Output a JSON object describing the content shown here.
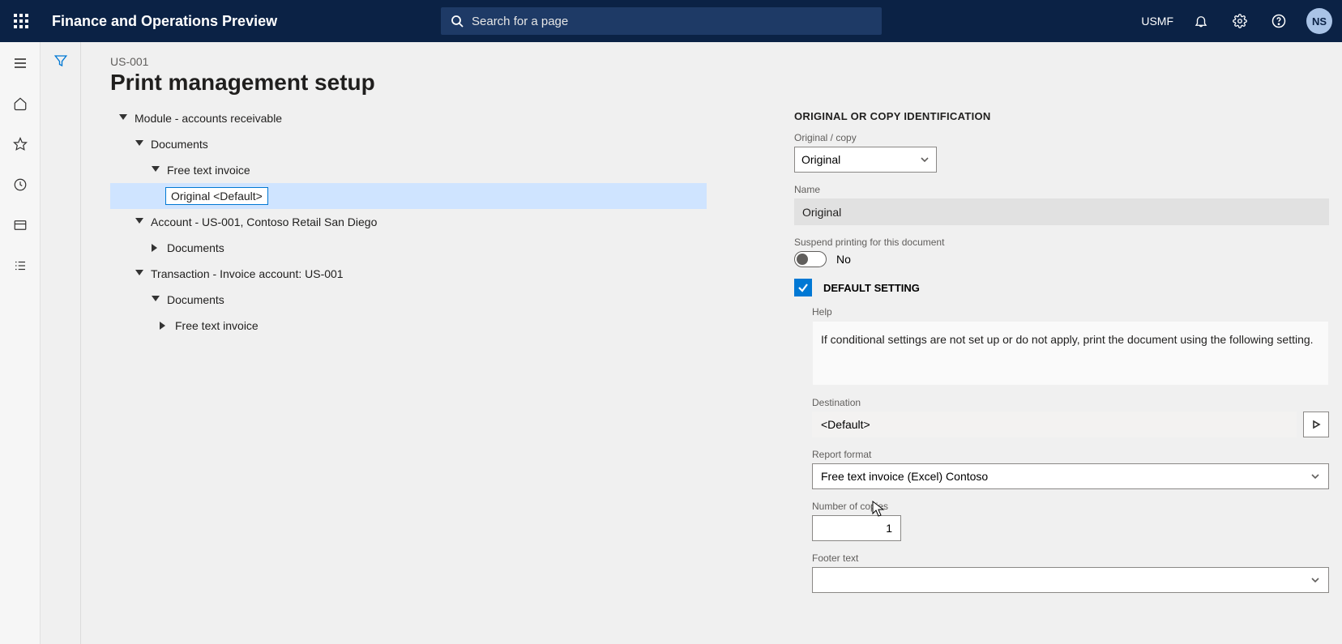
{
  "header": {
    "app_title": "Finance and Operations Preview",
    "search_placeholder": "Search for a page",
    "company": "USMF",
    "avatar_initials": "NS"
  },
  "page": {
    "crumb": "US-001",
    "title": "Print management setup"
  },
  "tree": {
    "module": "Module - accounts receivable",
    "documents": "Documents",
    "free_text_invoice": "Free text invoice",
    "original_default": "Original <Default>",
    "account": "Account - US-001, Contoso Retail San Diego",
    "account_documents": "Documents",
    "transaction": "Transaction - Invoice account: US-001",
    "trans_documents": "Documents",
    "trans_free_text": "Free text invoice"
  },
  "form": {
    "section_id_title": "ORIGINAL OR COPY IDENTIFICATION",
    "original_copy_label": "Original / copy",
    "original_copy_value": "Original",
    "name_label": "Name",
    "name_value": "Original",
    "suspend_label": "Suspend printing for this document",
    "suspend_value": "No",
    "default_setting_label": "DEFAULT SETTING",
    "help_label": "Help",
    "help_text": "If conditional settings are not set up or do not apply, print the document using the following setting.",
    "destination_label": "Destination",
    "destination_value": "<Default>",
    "report_format_label": "Report format",
    "report_format_value": "Free text invoice (Excel) Contoso",
    "copies_label": "Number of copies",
    "copies_value": "1",
    "footer_label": "Footer text",
    "footer_value": ""
  }
}
